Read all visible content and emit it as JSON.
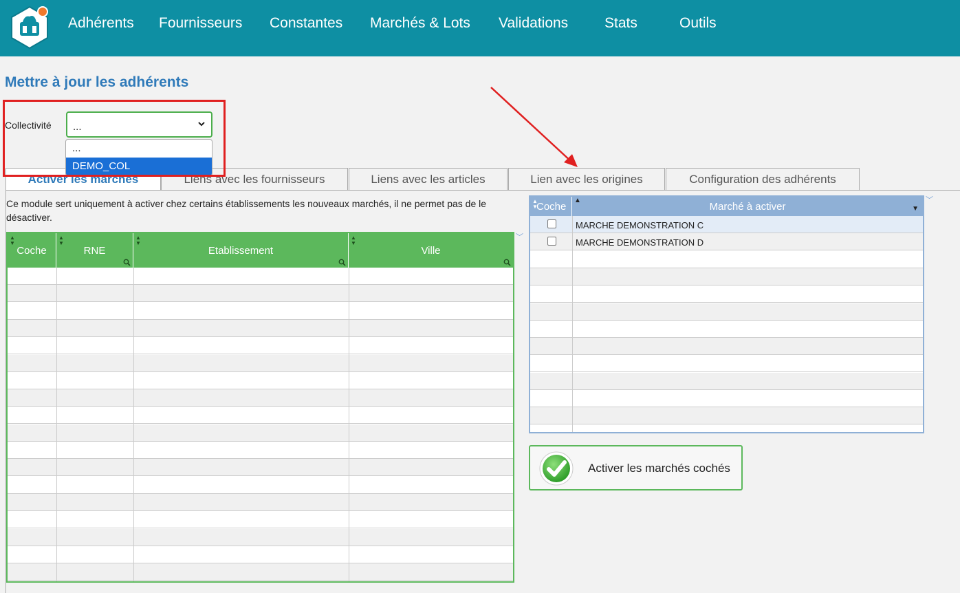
{
  "nav": {
    "items": [
      "Adhérents",
      "Fournisseurs",
      "Constantes",
      "Marchés & Lots",
      "Validations",
      "Stats",
      "Outils"
    ]
  },
  "page": {
    "title": "Mettre à jour les adhérents"
  },
  "collectivite": {
    "label": "Collectivité",
    "value": "...",
    "options": [
      "...",
      "DEMO_COL"
    ],
    "highlighted_option": "DEMO_COL"
  },
  "tabs": [
    "Activer les marchés",
    "Liens avec les fournisseurs",
    "Liens avec les articles",
    "Lien avec les origines",
    "Configuration des adhérents"
  ],
  "description": "Ce module sert uniquement à activer chez certains établissements les nouveaux marchés, il ne permet pas de le désactiver.",
  "establishments_grid": {
    "columns": [
      "Coche",
      "RNE",
      "Etablissement",
      "Ville"
    ],
    "rows": []
  },
  "markets_grid": {
    "columns": [
      "Coche",
      "Marché à activer"
    ],
    "rows": [
      {
        "checked": false,
        "label": "MARCHE DEMONSTRATION C"
      },
      {
        "checked": false,
        "label": "MARCHE DEMONSTRATION D"
      }
    ]
  },
  "activate_button": {
    "label": "Activer les marchés cochés",
    "icon": "check-icon"
  },
  "colors": {
    "topbar": "#0e8fa3",
    "title": "#2f7ab9",
    "grid_left_header": "#5cb85c",
    "grid_right_header": "#8fb0d6",
    "annotation": "#e02020"
  }
}
